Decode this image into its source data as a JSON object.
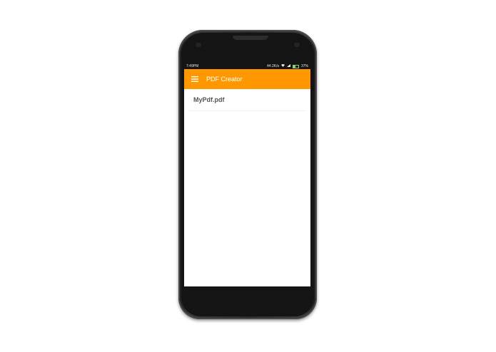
{
  "status_bar": {
    "time": "7:49PM",
    "network_speed": "44.2K/s",
    "battery_percent": "37%"
  },
  "app_bar": {
    "title": "PDF Creator",
    "menu_icon": "hamburger-menu-icon"
  },
  "files": [
    {
      "name": "MyPdf.pdf"
    }
  ],
  "colors": {
    "accent": "#ff9800",
    "status_bar_bg": "#141414",
    "phone_body": "#2a2a2a"
  }
}
